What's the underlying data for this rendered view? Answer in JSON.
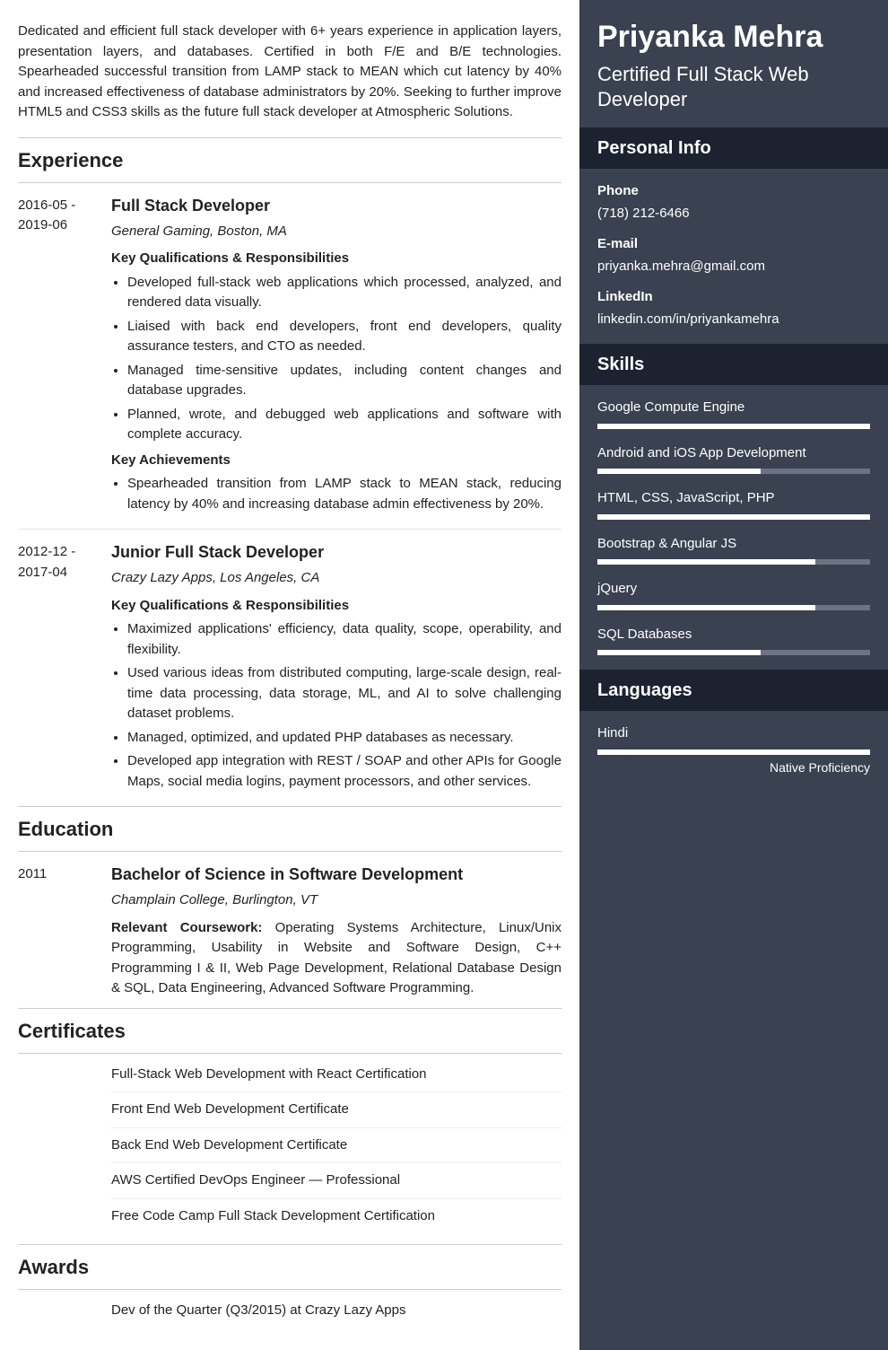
{
  "name": "Priyanka Mehra",
  "role": "Certified Full Stack Web Developer",
  "summary": "Dedicated and efficient full stack developer with 6+ years experience in application layers, presentation layers, and databases. Certified in both F/E and B/E technologies. Spearheaded successful transition from LAMP stack to MEAN which cut latency by 40% and increased effectiveness of database administrators by 20%. Seeking to further improve HTML5 and CSS3 skills as the future full stack developer at Atmospheric Solutions.",
  "sections": {
    "experience": "Experience",
    "education": "Education",
    "certificates": "Certificates",
    "awards": "Awards",
    "personal_info": "Personal Info",
    "skills": "Skills",
    "languages": "Languages"
  },
  "experience": [
    {
      "date": "2016-05 - 2019-06",
      "title": "Full Stack Developer",
      "company": "General Gaming, Boston, MA",
      "resp_heading": "Key Qualifications & Responsibilities",
      "responsibilities": [
        "Developed full-stack web applications which processed, analyzed, and rendered data visually.",
        "Liaised with back end developers, front end developers, quality assurance testers, and CTO as needed.",
        "Managed time-sensitive updates, including content changes and database upgrades.",
        "Planned, wrote, and debugged web applications and software with complete accuracy."
      ],
      "ach_heading": "Key Achievements",
      "achievements": [
        "Spearheaded transition from LAMP stack to MEAN stack, reducing latency by 40% and increasing database admin effectiveness by 20%."
      ]
    },
    {
      "date": "2012-12 - 2017-04",
      "title": "Junior Full Stack Developer",
      "company": "Crazy Lazy Apps, Los Angeles, CA",
      "resp_heading": "Key Qualifications & Responsibilities",
      "responsibilities": [
        "Maximized applications' efficiency, data quality, scope, operability, and flexibility.",
        "Used various ideas from distributed computing, large-scale design, real-time data processing, data storage, ML, and AI to solve challenging dataset problems.",
        "Managed, optimized, and updated PHP databases as necessary.",
        "Developed app integration with REST / SOAP and other APIs for Google Maps, social media logins, payment processors, and other services."
      ]
    }
  ],
  "education": [
    {
      "date": "2011",
      "title": "Bachelor of Science in Software Development",
      "school": "Champlain College, Burlington, VT",
      "coursework_label": "Relevant Coursework:",
      "coursework": "Operating Systems Architecture, Linux/Unix Programming, Usability in Website and Software Design, C++ Programming I & II, Web Page Development, Relational Database Design & SQL, Data Engineering, Advanced Software Programming."
    }
  ],
  "certificates": [
    "Full-Stack Web Development with React Certification",
    "Front End Web Development Certificate",
    "Back End Web Development Certificate",
    "AWS Certified DevOps Engineer — Professional",
    "Free Code Camp Full Stack Development Certification"
  ],
  "awards": [
    "Dev of the Quarter (Q3/2015) at Crazy Lazy Apps"
  ],
  "personal_info": {
    "phone_label": "Phone",
    "phone": "(718) 212-6466",
    "email_label": "E-mail",
    "email": "priyanka.mehra@gmail.com",
    "linkedin_label": "LinkedIn",
    "linkedin": "linkedin.com/in/priyankamehra"
  },
  "skills": [
    {
      "name": "Google Compute Engine",
      "level": 100
    },
    {
      "name": "Android and iOS App Development",
      "level": 60
    },
    {
      "name": "HTML, CSS, JavaScript, PHP",
      "level": 100
    },
    {
      "name": "Bootstrap & Angular JS",
      "level": 80
    },
    {
      "name": "jQuery",
      "level": 80
    },
    {
      "name": "SQL Databases",
      "level": 60
    }
  ],
  "languages": [
    {
      "name": "Hindi",
      "level": 100,
      "label": "Native Proficiency"
    }
  ]
}
